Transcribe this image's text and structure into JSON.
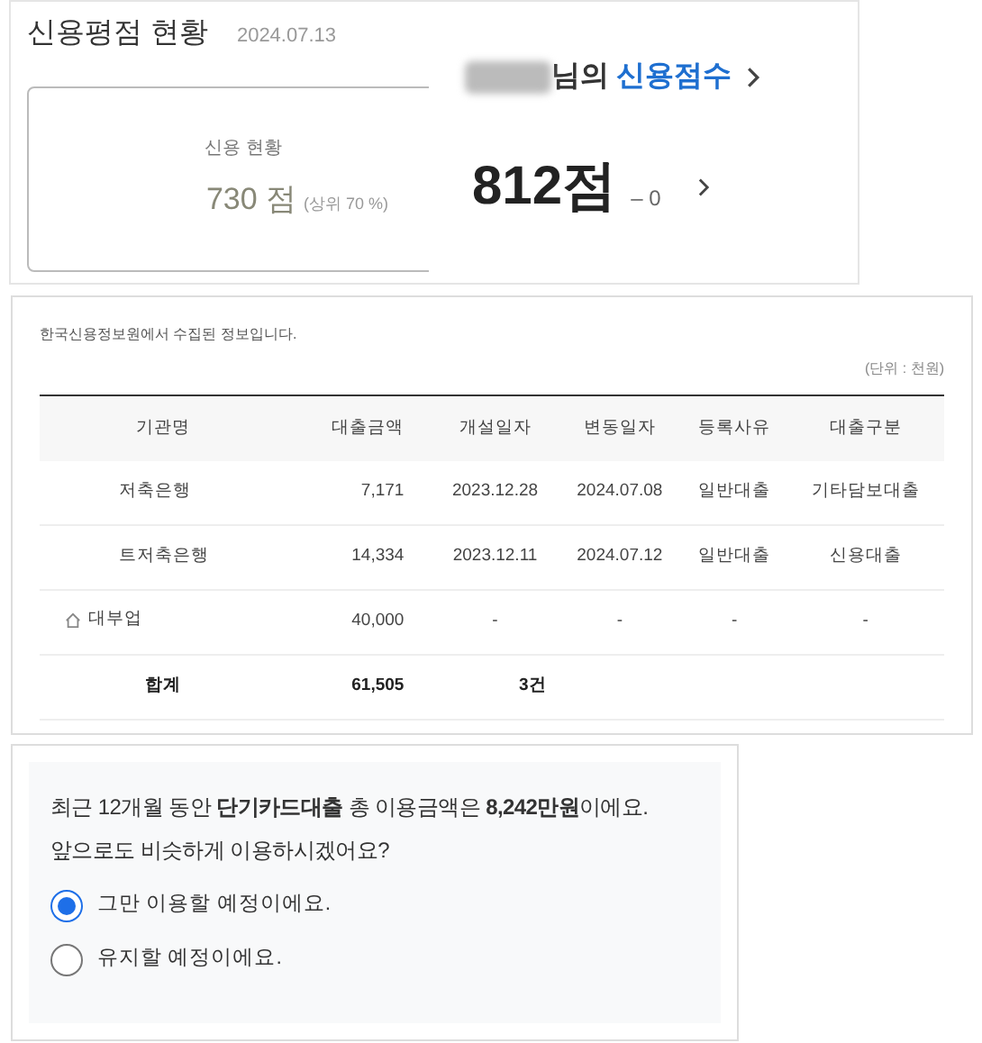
{
  "credit_status": {
    "title": "신용평점 현황",
    "date": "2024.07.13",
    "box_label": "신용 현황",
    "score": "730 점",
    "percentile": "(상위 70 %)"
  },
  "credit_score": {
    "suffix": "님의",
    "link": "신용점수",
    "score": "812점",
    "change": "– 0"
  },
  "loans": {
    "note": "한국신용정보원에서 수집된 정보입니다.",
    "unit": "(단위 : 천원)",
    "columns": [
      "기관명",
      "대출금액",
      "개설일자",
      "변동일자",
      "등록사유",
      "대출구분"
    ],
    "rows": [
      {
        "kind": "bank",
        "cells": [
          "저축은행",
          "7,171",
          "2023.12.28",
          "2024.07.08",
          "일반대출",
          "기타담보대출"
        ]
      },
      {
        "kind": "bank",
        "cells": [
          "트저축은행",
          "14,334",
          "2023.12.11",
          "2024.07.12",
          "일반대출",
          "신용대출"
        ]
      },
      {
        "kind": "lender",
        "cells": [
          "대부업",
          "40,000",
          "-",
          "-",
          "-",
          "-"
        ]
      }
    ],
    "total": [
      "합계",
      "61,505",
      "3건"
    ]
  },
  "survey": {
    "question": "최근 12개월 동안 **단기카드대출** 총 이용금액은 **8,242만원**이에요.",
    "question_2": "앞으로도 비슷하게 이용하시겠어요?",
    "options": [
      {
        "label": "그만 이용할 예정이에요.",
        "selected": true
      },
      {
        "label": "유지할 예정이에요.",
        "selected": false
      }
    ]
  }
}
